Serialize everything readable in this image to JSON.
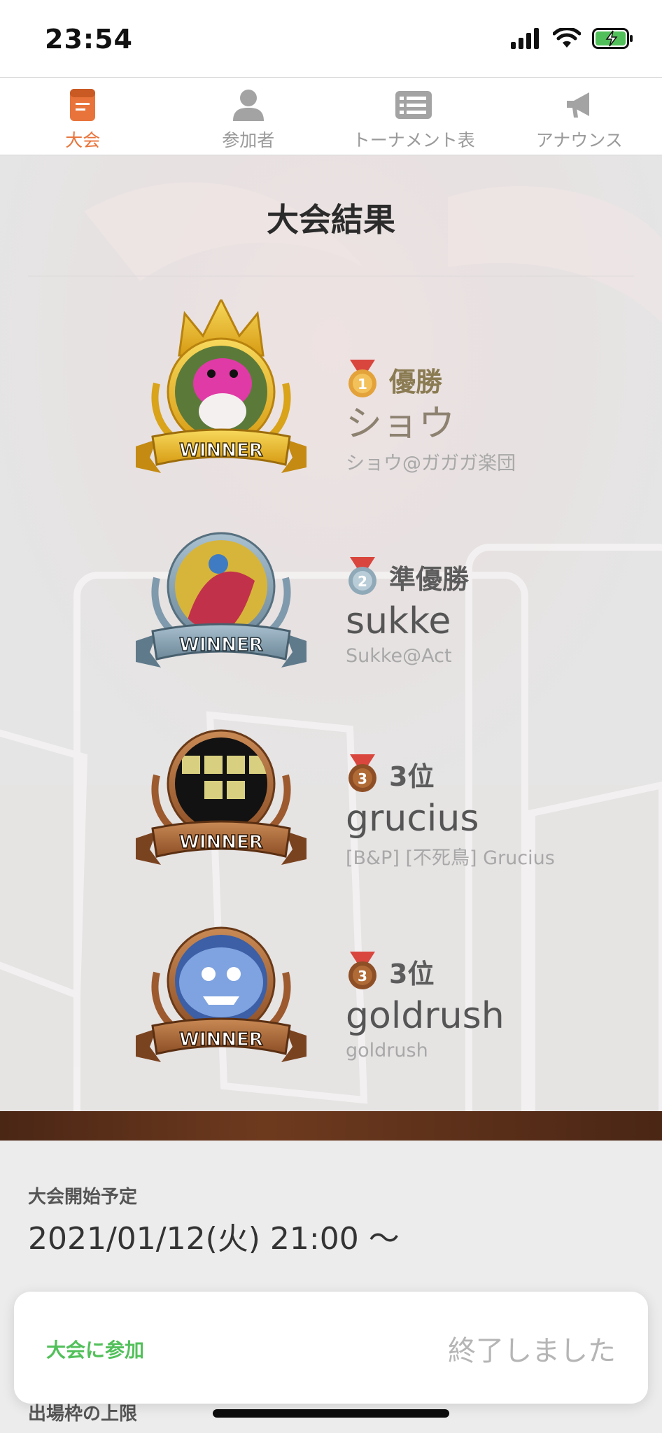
{
  "status_bar": {
    "time": "23:54"
  },
  "tabs": [
    {
      "label": "大会",
      "icon": "tournament-doc-icon",
      "active": true
    },
    {
      "label": "参加者",
      "icon": "person-icon",
      "active": false
    },
    {
      "label": "トーナメント表",
      "icon": "bracket-list-icon",
      "active": false
    },
    {
      "label": "アナウンス",
      "icon": "megaphone-icon",
      "active": false
    }
  ],
  "results": {
    "title": "大会結果",
    "entries": [
      {
        "medal": "1",
        "rank": "優勝",
        "name": "ショウ",
        "handle": "ショウ@ガガガ楽団",
        "badge_text": "WINNER",
        "tier": "gold"
      },
      {
        "medal": "2",
        "rank": "準優勝",
        "name": "sukke",
        "handle": "Sukke@Act",
        "badge_text": "WINNER",
        "tier": "silver"
      },
      {
        "medal": "3",
        "rank": "3位",
        "name": "grucius",
        "handle": "[B&P] [不死鳥] Grucius",
        "badge_text": "WINNER",
        "tier": "bronze"
      },
      {
        "medal": "3",
        "rank": "3位",
        "name": "goldrush",
        "handle": "goldrush",
        "badge_text": "WINNER",
        "tier": "bronze"
      }
    ]
  },
  "details": {
    "start_label": "大会開始予定",
    "start_value": "2021/01/12(火) 21:00 ～",
    "next_label": "出場枠の上限"
  },
  "join_bar": {
    "join_label": "大会に参加",
    "status_label": "終了しました"
  },
  "colors": {
    "accent": "#e8743b",
    "join_green": "#52c05a",
    "gold": "#e3b52a",
    "silver": "#7f9aac",
    "bronze": "#9c5a2e"
  }
}
